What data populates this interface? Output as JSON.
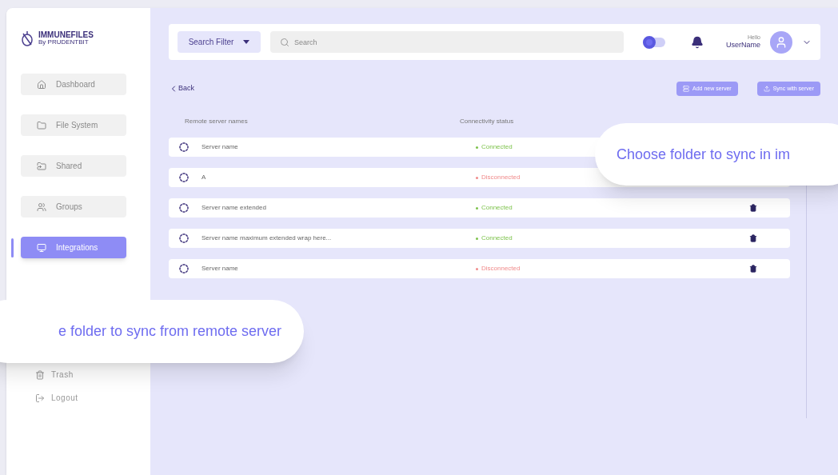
{
  "brand": {
    "name": "IMMUNEFILES",
    "tagline": "By PRUDENTBIT"
  },
  "sidebar": {
    "items": [
      {
        "label": "Dashboard",
        "selected": false
      },
      {
        "label": "File System",
        "selected": false
      },
      {
        "label": "Shared",
        "selected": false
      },
      {
        "label": "Groups",
        "selected": false
      },
      {
        "label": "Integrations",
        "selected": true
      }
    ],
    "bottom": [
      {
        "label": "Trash"
      },
      {
        "label": "Logout"
      }
    ]
  },
  "topbar": {
    "filter": "Search Filter",
    "search_placeholder": "Search",
    "toggle_on": false,
    "greeting": "Hello",
    "username": "UserName"
  },
  "back": "Back",
  "actions": [
    {
      "label": "Add new server"
    },
    {
      "label": "Sync with server"
    }
  ],
  "table": {
    "columns": [
      "Remote server names",
      "Connectivity status"
    ],
    "rows": [
      {
        "name": "Server name",
        "status": "Connected",
        "connected": true
      },
      {
        "name": "A",
        "status": "Disconnected",
        "connected": false
      },
      {
        "name": "Server name extended",
        "status": "Connected",
        "connected": true
      },
      {
        "name": "Server name maximum extended wrap here...",
        "status": "Connected",
        "connected": true
      },
      {
        "name": "Server name",
        "status": "Disconnected",
        "connected": false
      }
    ]
  },
  "callouts": [
    {
      "text": "Choose folder to sync in im"
    },
    {
      "text": "e folder to sync from remote server"
    }
  ]
}
